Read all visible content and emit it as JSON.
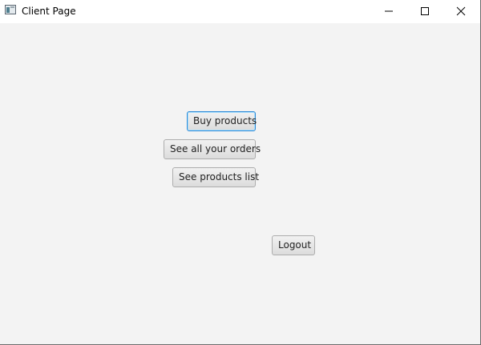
{
  "window": {
    "title": "Client Page",
    "icons": {
      "app": "window-app-icon",
      "minimize": "minimize-icon",
      "maximize": "maximize-icon",
      "close": "close-icon"
    },
    "focus_color": "#2b8ad8",
    "background_color": "#f3f3f3"
  },
  "buttons": {
    "buy_products": "Buy products",
    "see_orders": "See all your orders",
    "see_products_list": "See products list",
    "logout": "Logout"
  }
}
